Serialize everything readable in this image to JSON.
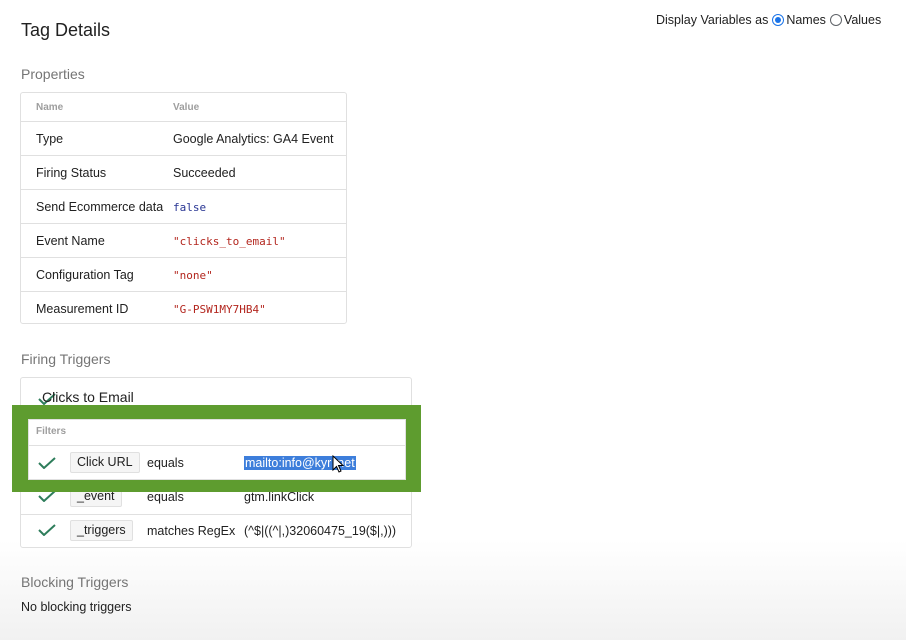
{
  "header": {
    "title": "Tag Details",
    "display_variables_label": "Display Variables as",
    "option_names": "Names",
    "option_values": "Values",
    "selected_option": "Names"
  },
  "properties": {
    "section_label": "Properties",
    "col_name": "Name",
    "col_value": "Value",
    "rows": [
      {
        "name": "Type",
        "value": "Google Analytics: GA4 Event"
      },
      {
        "name": "Firing Status",
        "value": "Succeeded"
      },
      {
        "name": "Send Ecommerce data",
        "value": "false"
      },
      {
        "name": "Event Name",
        "value": "\"clicks_to_email\""
      },
      {
        "name": "Configuration Tag",
        "value": "\"none\""
      },
      {
        "name": "Measurement ID",
        "value": "\"G-PSW1MY7HB4\""
      }
    ]
  },
  "firing_triggers": {
    "section_label": "Firing Triggers",
    "trigger_name": "Clicks to Email",
    "filters_label": "Filters",
    "filters": [
      {
        "variable": "Click URL",
        "operator": "equals",
        "value": "mailto:info@kyr .net"
      },
      {
        "variable": "_event",
        "operator": "equals",
        "value": "gtm.linkClick"
      },
      {
        "variable": "_triggers",
        "operator": "matches RegEx",
        "value": "(^$|((^|,)32060475_19($|,)))"
      }
    ]
  },
  "blocking_triggers": {
    "section_label": "Blocking Triggers",
    "empty_text": "No blocking triggers"
  },
  "colors": {
    "highlight_frame": "#5e9c2f",
    "check": "#2e7d5b",
    "selection": "#3d7edb",
    "string_value": "#b3261e"
  }
}
